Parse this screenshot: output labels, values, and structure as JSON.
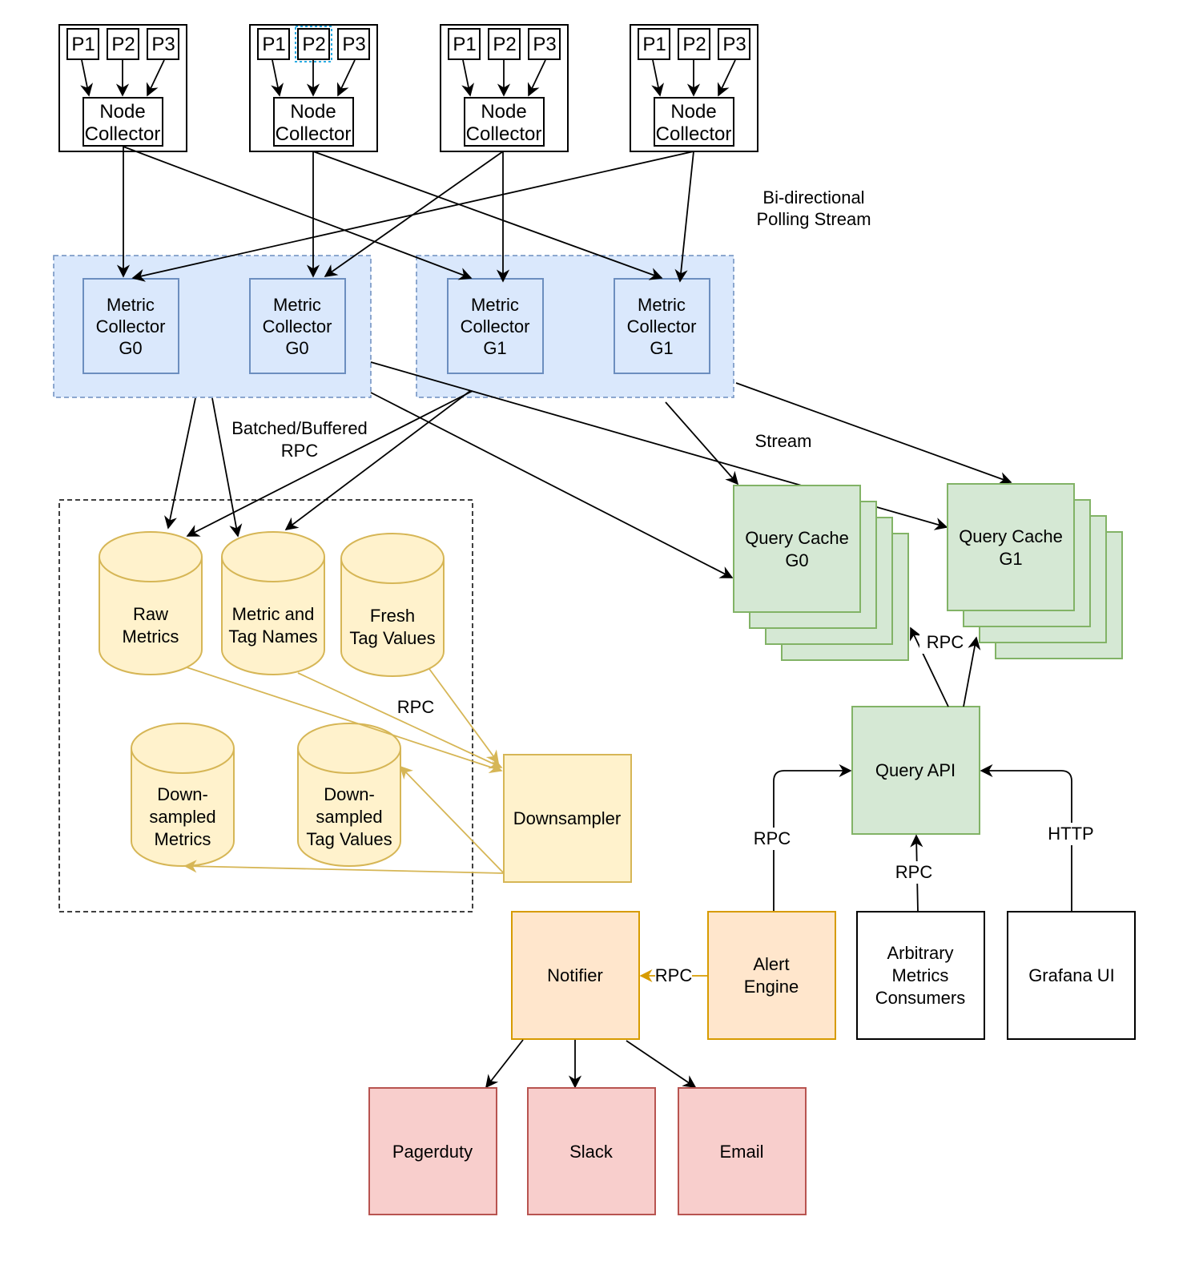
{
  "colors": {
    "blue_fill": "#dae8fc",
    "blue_stroke": "#6c8ebf",
    "yellow_fill": "#fff2cc",
    "yellow_stroke": "#d6b656",
    "green_fill": "#d5e8d4",
    "green_stroke": "#82b366",
    "orange_fill": "#ffe6cc",
    "orange_stroke": "#d79b00",
    "red_fill": "#f8cecc",
    "red_stroke": "#b85450",
    "selection": "#29abe2"
  },
  "nodes": [
    {
      "processes": [
        "P1",
        "P2",
        "P3"
      ],
      "collector": [
        "Node",
        "Collector"
      ]
    },
    {
      "processes": [
        "P1",
        "P2",
        "P3"
      ],
      "collector": [
        "Node",
        "Collector"
      ],
      "selected_process": "P2"
    },
    {
      "processes": [
        "P1",
        "P2",
        "P3"
      ],
      "collector": [
        "Node",
        "Collector"
      ]
    },
    {
      "processes": [
        "P1",
        "P2",
        "P3"
      ],
      "collector": [
        "Node",
        "Collector"
      ]
    }
  ],
  "metric_collectors": [
    {
      "lines": [
        "Metric",
        "Collector",
        "G0"
      ]
    },
    {
      "lines": [
        "Metric",
        "Collector",
        "G0"
      ]
    },
    {
      "lines": [
        "Metric",
        "Collector",
        "G1"
      ]
    },
    {
      "lines": [
        "Metric",
        "Collector",
        "G1"
      ]
    }
  ],
  "labels": {
    "bidirectional": [
      "Bi-directional",
      "Polling Stream"
    ],
    "batched": [
      "Batched/Buffered",
      "RPC"
    ],
    "stream": "Stream",
    "rpc_downsampler": "RPC",
    "rpc_cache": "RPC",
    "rpc_alert": "RPC",
    "rpc_consumers": "RPC",
    "http_grafana": "HTTP",
    "rpc_notifier": "RPC"
  },
  "storage": [
    {
      "lines": [
        "Raw",
        "Metrics"
      ]
    },
    {
      "lines": [
        "Metric and",
        "Tag Names"
      ]
    },
    {
      "lines": [
        "Fresh",
        "Tag Values"
      ]
    },
    {
      "lines": [
        "Down-",
        "sampled",
        "Metrics"
      ]
    },
    {
      "lines": [
        "Down-",
        "sampled",
        "Tag Values"
      ]
    }
  ],
  "downsampler": "Downsampler",
  "query_caches": [
    {
      "lines": [
        "Query Cache",
        "G0"
      ]
    },
    {
      "lines": [
        "Query Cache",
        "G1"
      ]
    }
  ],
  "query_api": "Query API",
  "alert_engine": [
    "Alert",
    "Engine"
  ],
  "consumers": [
    "Arbitrary",
    "Metrics",
    "Consumers"
  ],
  "grafana": "Grafana UI",
  "notifier": "Notifier",
  "destinations": [
    "Pagerduty",
    "Slack",
    "Email"
  ]
}
